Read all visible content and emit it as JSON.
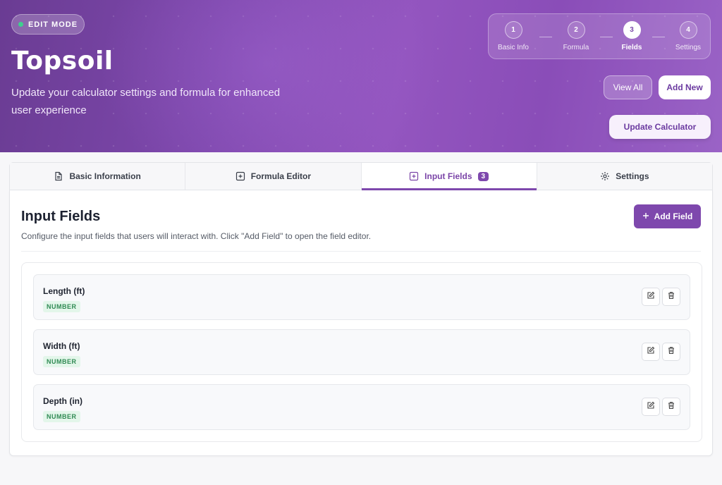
{
  "hero": {
    "badge": "EDIT MODE",
    "title": "Topsoil",
    "subtitle": "Update your calculator settings and formula for enhanced user experience",
    "view_all_label": "View All",
    "add_new_label": "Add New",
    "update_label": "Update Calculator"
  },
  "stepper": {
    "steps": [
      {
        "number": "1",
        "label": "Basic Info"
      },
      {
        "number": "2",
        "label": "Formula"
      },
      {
        "number": "3",
        "label": "Fields",
        "active": true
      },
      {
        "number": "4",
        "label": "Settings"
      }
    ]
  },
  "tabs": [
    {
      "label": "Basic Information",
      "icon": "document-icon"
    },
    {
      "label": "Formula Editor",
      "icon": "plus-square-icon"
    },
    {
      "label": "Input Fields",
      "icon": "plus-square-icon",
      "count": "3",
      "active": true
    },
    {
      "label": "Settings",
      "icon": "gear-icon"
    }
  ],
  "panel": {
    "title": "Input Fields",
    "description": "Configure the input fields that users will interact with. Click \"Add Field\" to open the field editor.",
    "add_field_label": "Add Field"
  },
  "fields": [
    {
      "name": "Length (ft)",
      "type": "NUMBER"
    },
    {
      "name": "Width (ft)",
      "type": "NUMBER"
    },
    {
      "name": "Depth (in)",
      "type": "NUMBER"
    }
  ],
  "colors": {
    "accent": "#7e48ad",
    "badge_green": "#2f8a53",
    "status_dot": "#3fcf8e"
  }
}
